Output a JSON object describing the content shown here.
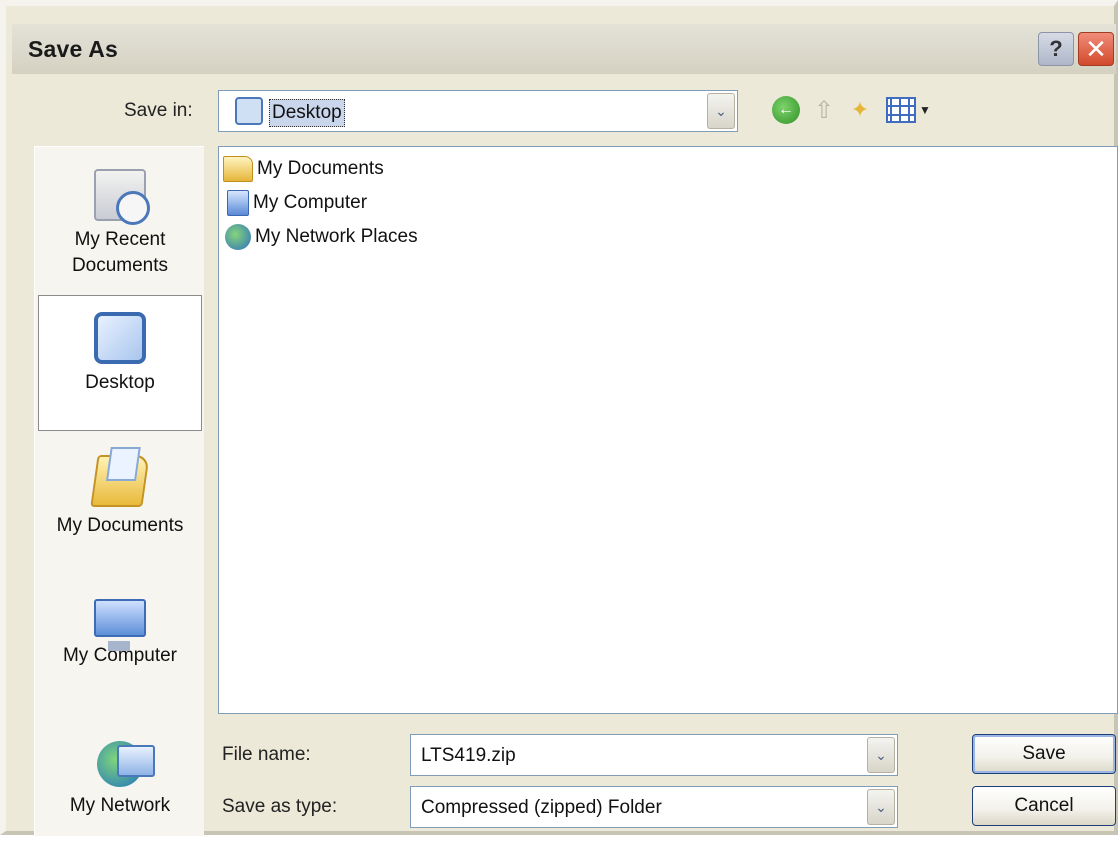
{
  "window": {
    "title": "Save As",
    "help_glyph": "?",
    "close_glyph": "✕"
  },
  "save_in": {
    "label": "Save in:",
    "value": "Desktop",
    "icon": "desktop-icon"
  },
  "toolbar": {
    "icons": [
      "back-icon",
      "up-one-level-icon",
      "new-folder-icon",
      "views-menu-icon"
    ]
  },
  "places": [
    {
      "label_lines": [
        "My Recent",
        "Documents"
      ],
      "icon": "recent-documents-icon"
    },
    {
      "label_lines": [
        "Desktop"
      ],
      "icon": "desktop-icon",
      "selected": true
    },
    {
      "label_lines": [
        "My Documents"
      ],
      "icon": "my-documents-icon"
    },
    {
      "label_lines": [
        "My Computer"
      ],
      "icon": "my-computer-icon"
    },
    {
      "label_lines": [
        "My Network"
      ],
      "icon": "my-network-icon"
    }
  ],
  "files": [
    {
      "name": "My Documents",
      "icon": "folder-icon"
    },
    {
      "name": "My Computer",
      "icon": "computer-icon"
    },
    {
      "name": "My Network Places",
      "icon": "network-places-icon"
    }
  ],
  "file_name": {
    "label": "File name:",
    "value": "LTS419.zip"
  },
  "save_as_type": {
    "label": "Save as type:",
    "value": "Compressed (zipped) Folder"
  },
  "buttons": {
    "save": "Save",
    "cancel": "Cancel"
  },
  "dropdown_glyph": "⌄",
  "colors": {
    "dialog_bg": "#ece9d8",
    "places_bg": "#f6f5ef",
    "border_blue": "#7f9db9",
    "close_red": "#d24a2c"
  }
}
